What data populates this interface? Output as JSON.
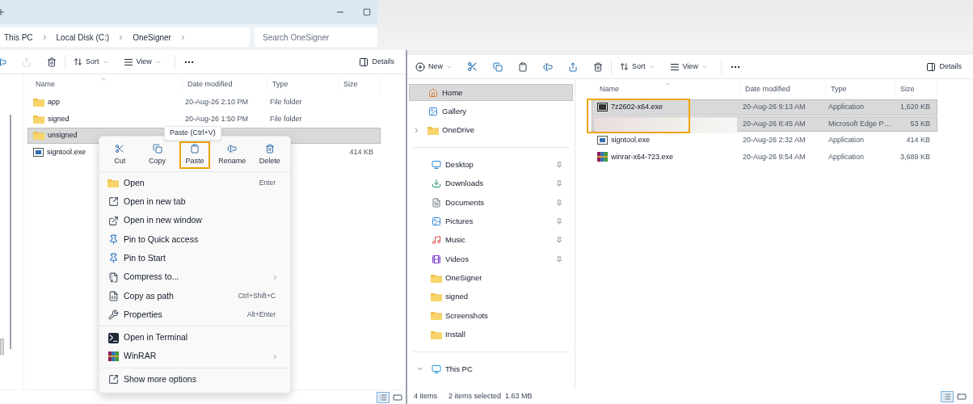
{
  "left_window": {
    "breadcrumb": [
      "This PC",
      "Local Disk (C:)",
      "OneSigner"
    ],
    "search": {
      "placeholder": "Search OneSigner"
    },
    "toolbar": {
      "sort": "Sort",
      "view": "View",
      "details": "Details"
    },
    "columns": [
      "Name",
      "Date modified",
      "Type",
      "Size"
    ],
    "rows": [
      {
        "kind": "folder",
        "name": "app",
        "date": "20-Aug-26 2:10 PM",
        "type": "File folder",
        "selected": false
      },
      {
        "kind": "folder",
        "name": "signed",
        "date": "20-Aug-26 1:50 PM",
        "type": "File folder",
        "selected": false
      },
      {
        "kind": "folder",
        "name": "unsigned",
        "selected": true
      },
      {
        "kind": "app",
        "name": "signtool.exe",
        "size": "414 KB",
        "selected": false
      }
    ]
  },
  "context_menu": {
    "tooltip": "Paste (Ctrl+V)",
    "actions": [
      {
        "label": "Cut",
        "highlighted": false
      },
      {
        "label": "Copy",
        "highlighted": false
      },
      {
        "label": "Paste",
        "highlighted": true
      },
      {
        "label": "Rename",
        "highlighted": false
      },
      {
        "label": "Delete",
        "highlighted": false
      }
    ],
    "sections": [
      [
        {
          "label": "Open",
          "shortcut": "Enter"
        },
        {
          "label": "Open in new tab"
        },
        {
          "label": "Open in new window"
        },
        {
          "label": "Pin to Quick access"
        },
        {
          "label": "Pin to Start"
        },
        {
          "label": "Compress to...",
          "submenu": true
        },
        {
          "label": "Copy as path",
          "shortcut": "Ctrl+Shift+C"
        },
        {
          "label": "Properties",
          "shortcut": "Alt+Enter"
        }
      ],
      [
        {
          "label": "Open in Terminal"
        },
        {
          "label": "WinRAR",
          "submenu": true
        }
      ],
      [
        {
          "label": "Show more options"
        }
      ]
    ]
  },
  "right_window": {
    "toolbar": {
      "new": "New",
      "sort": "Sort",
      "view": "View",
      "details": "Details"
    },
    "sidebar": [
      [
        {
          "label": "Home",
          "selected": true
        },
        {
          "label": "Gallery",
          "selected": false
        },
        {
          "label": "OneDrive",
          "selected": false,
          "expanded": false
        }
      ],
      [
        {
          "label": "Desktop",
          "selected": false,
          "pinned": true
        },
        {
          "label": "Downloads",
          "selected": false,
          "pinned": true
        },
        {
          "label": "Documents",
          "selected": false,
          "pinned": true
        },
        {
          "label": "Pictures",
          "selected": false,
          "pinned": true
        },
        {
          "label": "Music",
          "selected": false,
          "pinned": true
        },
        {
          "label": "Videos",
          "selected": false,
          "pinned": true
        },
        {
          "label": "OneSigner",
          "selected": false,
          "pinned": false
        },
        {
          "label": "signed",
          "selected": false,
          "pinned": false
        },
        {
          "label": "Screenshots",
          "selected": false,
          "pinned": false
        },
        {
          "label": "Install",
          "selected": false,
          "pinned": false
        }
      ],
      [
        {
          "label": "This PC",
          "selected": false,
          "expanded": true
        }
      ]
    ],
    "columns": [
      "Name",
      "Date modified",
      "Type",
      "Size"
    ],
    "rows": [
      {
        "kind": "archive",
        "name": "7z2602-x64.exe",
        "date": "20-Aug-26 9:13 AM",
        "type": "Application",
        "size": "1,620 KB",
        "selected": true
      },
      {
        "kind": "hidden",
        "date": "20-Aug-26 8:45 AM",
        "type": "Microsoft Edge P…",
        "size": "53 KB",
        "selected": true
      },
      {
        "kind": "app",
        "name": "signtool.exe",
        "date": "20-Aug-26 2:32 AM",
        "type": "Application",
        "size": "414 KB",
        "selected": false
      },
      {
        "kind": "rar",
        "name": "winrar-x64-723.exe",
        "date": "20-Aug-26 9:54 AM",
        "type": "Application",
        "size": "3,689 KB",
        "selected": false
      }
    ],
    "status": {
      "count": "4 items",
      "selection": "2 items selected  1.63 MB"
    }
  }
}
